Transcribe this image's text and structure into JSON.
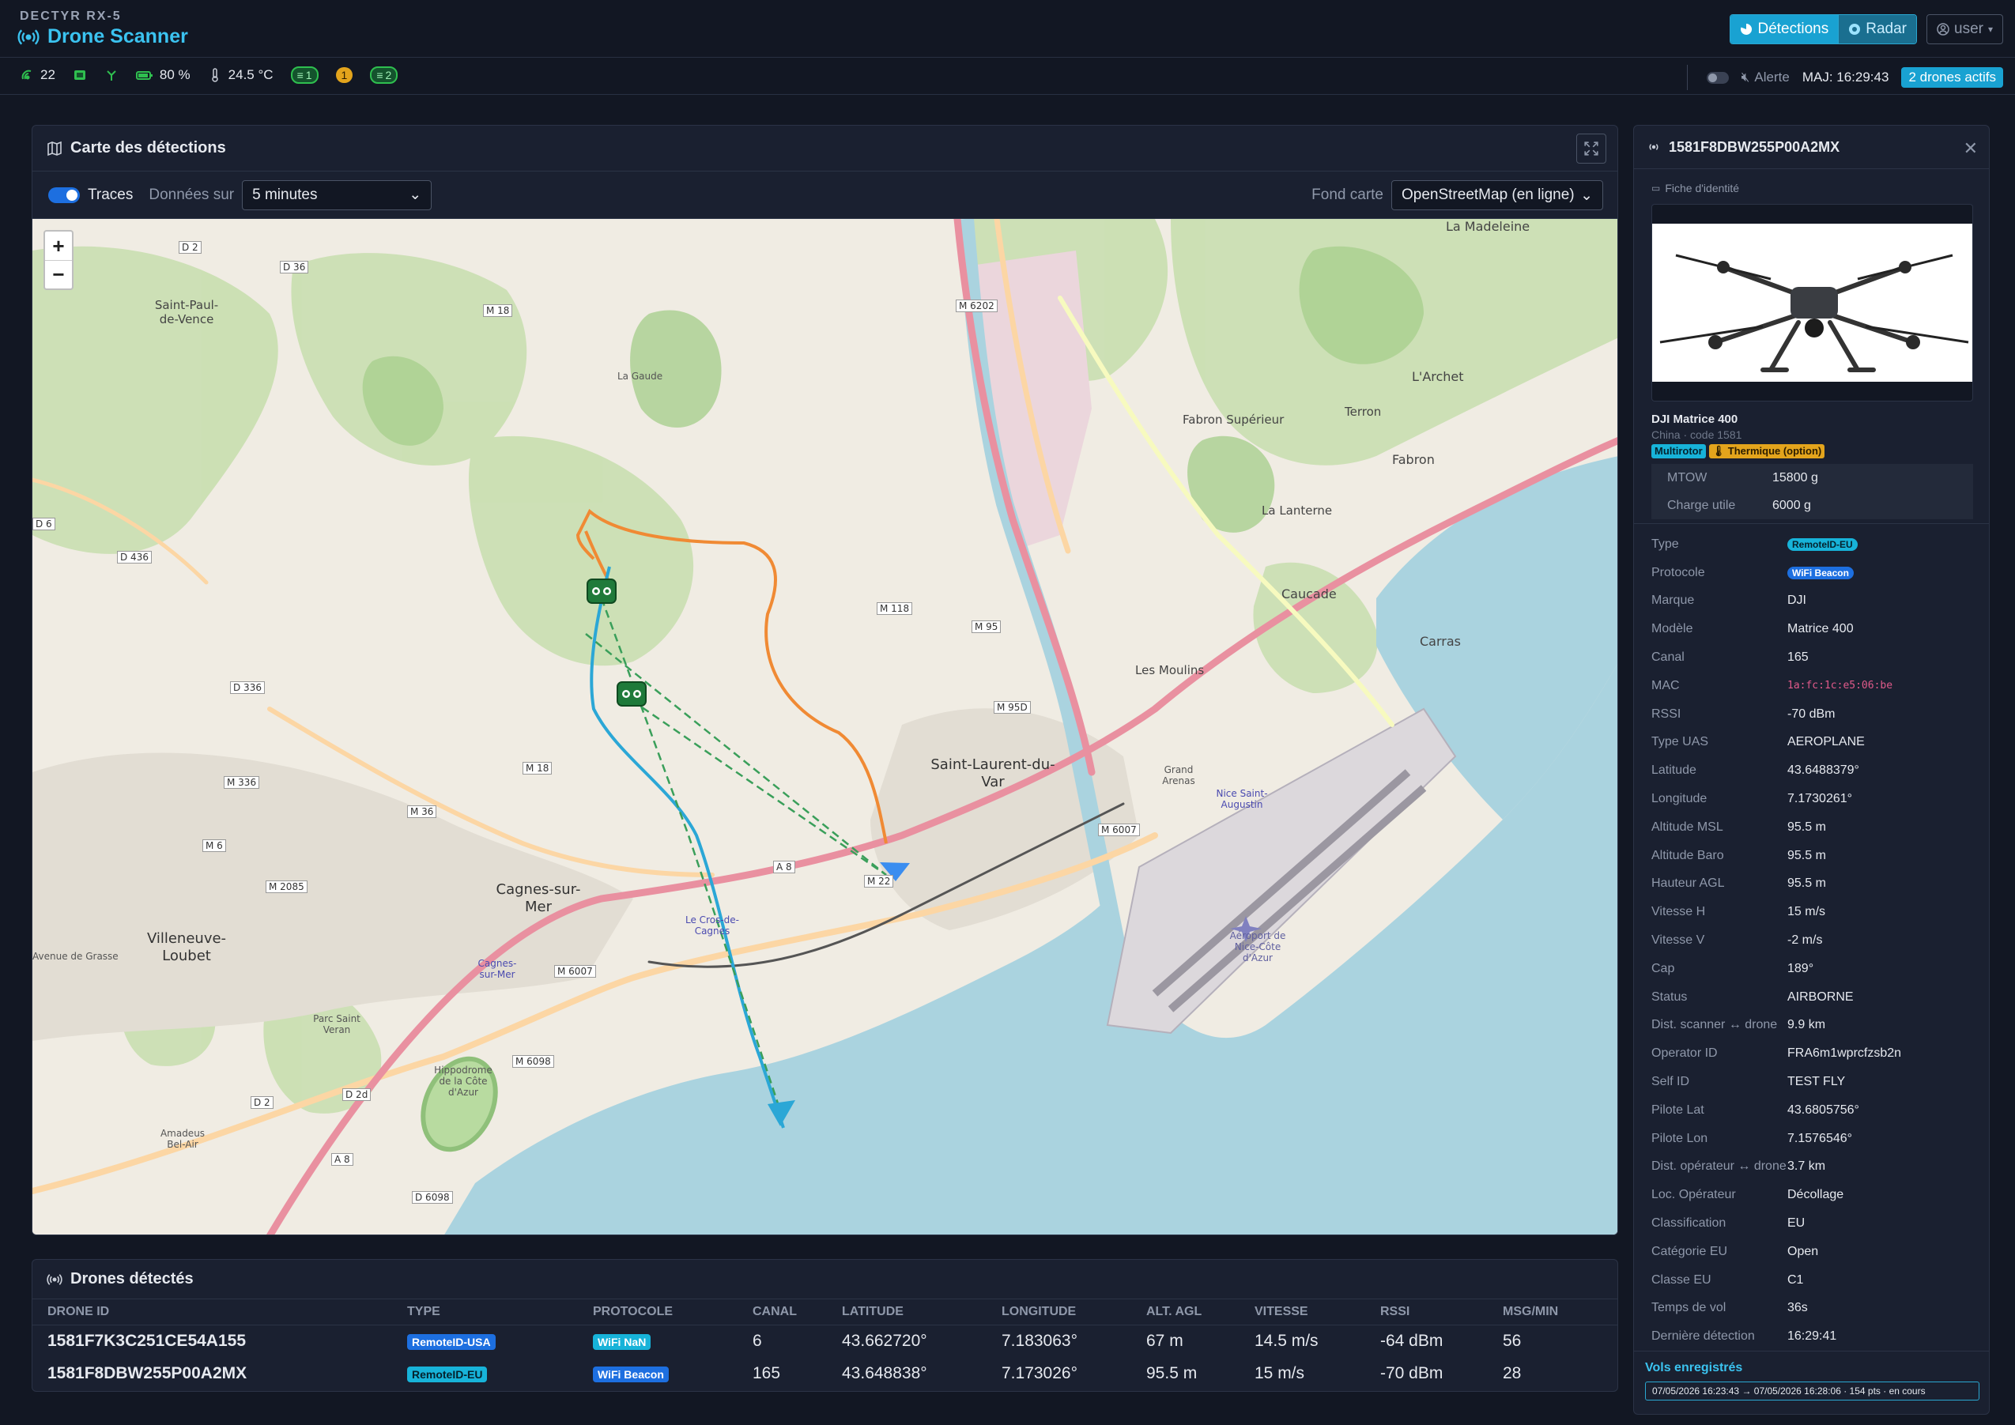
{
  "header": {
    "brand_small": "DECTYR RX-5",
    "title": "Drone Scanner",
    "btn_detections": "Détections",
    "btn_radar": "Radar",
    "btn_user": "user"
  },
  "status": {
    "satellites": "22",
    "battery": "80 %",
    "temperature": "24.5 °C",
    "pill1": "1",
    "pill_warn": "1",
    "pill2": "2",
    "alert_label": "Alerte",
    "last_update": "MAJ: 16:29:43",
    "active_badge": "2 drones actifs"
  },
  "map_panel": {
    "title": "Carte des détections",
    "traces_label": "Traces",
    "data_label": "Données sur",
    "data_value": "5 minutes",
    "basemap_label": "Fond carte",
    "basemap_value": "OpenStreetMap (en ligne)",
    "zoom_in": "+",
    "zoom_out": "−",
    "places": {
      "stlaurent": "Saint-Laurent-du-Var",
      "cagnes": "Cagnes-sur-Mer",
      "villeneuve": "Villeneuve-Loubet",
      "stpaul": "Saint-Paul-de-Vence",
      "fabron": "Fabron",
      "fabron_sup": "Fabron Supérieur",
      "terron": "Terron",
      "larchet": "L'Archet",
      "lalanterne": "La Lanterne",
      "caucade": "Caucade",
      "carras": "Carras",
      "lesmoulins": "Les Moulins",
      "lamadeleine": "La Madeleine",
      "aeroport": "Aéroport de Nice-Côte d'Azur",
      "hippodrome": "Hippodrome de la Côte d'Azur",
      "lecros": "Le Cros-de-Cagnes",
      "grandarenas": "Grand Arenas",
      "nicestaug": "Nice Saint-Augustin",
      "lagaude": "La Gaude",
      "cagnessm": "Cagnes-sur-Mer",
      "parcsv": "Parc Saint Veran",
      "amadeus": "Amadeus Bel-Air"
    },
    "roads": {
      "d2": "D 2",
      "d36": "D 36",
      "m18": "M 18",
      "m18b": "M 18",
      "d436": "D 436",
      "d336": "D 336",
      "m336": "M 336",
      "m6": "M 6",
      "m36": "M 36",
      "m2085": "M 2085",
      "m6007": "M 6007",
      "m6007b": "M 6007",
      "m6098": "M 6098",
      "d2d": "D 2d",
      "d2b": "D 2",
      "a8": "A 8",
      "a8b": "A 8",
      "d6098": "D 6098",
      "m6202": "M 6202",
      "m118": "M 118",
      "m95": "M 95",
      "m95d": "M 95D",
      "m22": "M 22",
      "d6": "D 6",
      "avgrasse": "Avenue de Grasse"
    }
  },
  "table": {
    "title": "Drones détectés",
    "columns": [
      "DRONE ID",
      "TYPE",
      "PROTOCOLE",
      "CANAL",
      "LATITUDE",
      "LONGITUDE",
      "ALT. AGL",
      "VITESSE",
      "RSSI",
      "MSG/MIN"
    ],
    "rows": [
      {
        "id": "1581F7K3C251CE54A155",
        "type": "RemoteID-USA",
        "protocol": "WiFi NaN",
        "channel": "6",
        "lat": "43.662720°",
        "lon": "7.183063°",
        "alt": "67 m",
        "speed": "14.5 m/s",
        "rssi": "-64 dBm",
        "msg": "56"
      },
      {
        "id": "1581F8DBW255P00A2MX",
        "type": "RemoteID-EU",
        "protocol": "WiFi Beacon",
        "channel": "165",
        "lat": "43.648838°",
        "lon": "7.173026°",
        "alt": "95.5 m",
        "speed": "15 m/s",
        "rssi": "-70 dBm",
        "msg": "28"
      }
    ]
  },
  "detail": {
    "title": "1581F8DBW255P00A2MX",
    "fiche": "Fiche d'identité",
    "model": "DJI Matrice 400",
    "origin": "China · code 1581",
    "tag_multi": "Multirotor",
    "tag_therm": "Thermique (option)",
    "spec": [
      {
        "k": "MTOW",
        "v": "15800 g"
      },
      {
        "k": "Charge utile",
        "v": "6000 g"
      }
    ],
    "props": [
      {
        "k": "Type",
        "v": "RemoteID-EU"
      },
      {
        "k": "Protocole",
        "v": "WiFi Beacon"
      },
      {
        "k": "Marque",
        "v": "DJI"
      },
      {
        "k": "Modèle",
        "v": "Matrice 400"
      },
      {
        "k": "Canal",
        "v": "165"
      },
      {
        "k": "MAC",
        "v": "1a:fc:1c:e5:06:be"
      },
      {
        "k": "RSSI",
        "v": "-70 dBm"
      },
      {
        "k": "Type UAS",
        "v": "AEROPLANE"
      },
      {
        "k": "Latitude",
        "v": "43.6488379°"
      },
      {
        "k": "Longitude",
        "v": "7.1730261°"
      },
      {
        "k": "Altitude MSL",
        "v": "95.5 m"
      },
      {
        "k": "Altitude Baro",
        "v": "95.5 m"
      },
      {
        "k": "Hauteur AGL",
        "v": "95.5 m"
      },
      {
        "k": "Vitesse H",
        "v": "15 m/s"
      },
      {
        "k": "Vitesse V",
        "v": "-2 m/s"
      },
      {
        "k": "Cap",
        "v": "189°"
      },
      {
        "k": "Status",
        "v": "AIRBORNE"
      },
      {
        "k": "Dist. scanner ↔ drone",
        "v": "9.9 km"
      },
      {
        "k": "Operator ID",
        "v": "FRA6m1wprcfzsb2n"
      },
      {
        "k": "Self ID",
        "v": "TEST FLY"
      },
      {
        "k": "Pilote Lat",
        "v": "43.6805756°"
      },
      {
        "k": "Pilote Lon",
        "v": "7.1576546°"
      },
      {
        "k": "Dist. opérateur ↔ drone",
        "v": "3.7 km"
      },
      {
        "k": "Loc. Opérateur",
        "v": "Décollage"
      },
      {
        "k": "Classification",
        "v": "EU"
      },
      {
        "k": "Catégorie EU",
        "v": "Open"
      },
      {
        "k": "Classe EU",
        "v": "C1"
      },
      {
        "k": "Temps de vol",
        "v": "36s"
      },
      {
        "k": "Dernière détection",
        "v": "16:29:41"
      }
    ],
    "vols_title": "Vols enregistrés",
    "vols_item": "07/05/2026 16:23:43 → 07/05/2026 16:28:06 · 154 pts · en cours"
  }
}
